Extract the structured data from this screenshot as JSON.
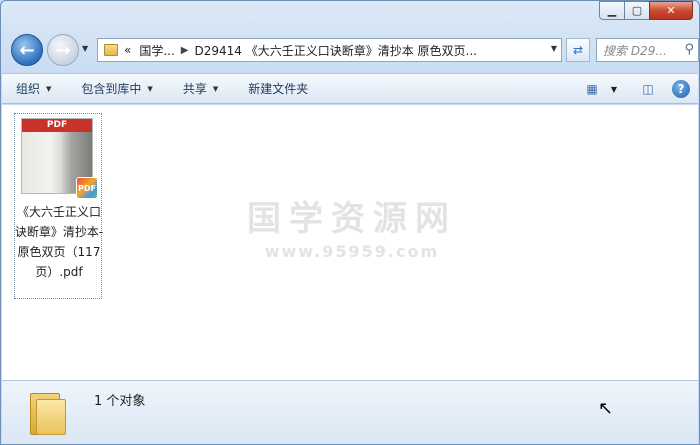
{
  "window": {
    "caption": {
      "minimize": "▁",
      "maximize": "▢",
      "close": "✕"
    }
  },
  "navigation": {
    "back_icon": "arrow-left-icon",
    "forward_icon": "arrow-right-icon",
    "breadcrumb": {
      "overflow": "«",
      "items": [
        "国学...",
        "D29414 《大六壬正义口诀断章》清抄本 原色双页..."
      ]
    },
    "search": {
      "placeholder": "搜索 D29..."
    }
  },
  "toolbar": {
    "organize": "组织",
    "include_in_library": "包含到库中",
    "share": "共享",
    "new_folder": "新建文件夹"
  },
  "content": {
    "file": {
      "thumb_label": "PDF",
      "badge": "PDF",
      "name": "《大六壬正义口诀断章》清抄本-原色双页（117页）.pdf"
    },
    "watermark": {
      "title": "国学资源网",
      "url": "www.95959.com"
    }
  },
  "details": {
    "count": "1 个对象"
  },
  "colors": {
    "accent": "#2d6fbd",
    "close": "#c94a30",
    "pdf_red": "#c8322b"
  }
}
